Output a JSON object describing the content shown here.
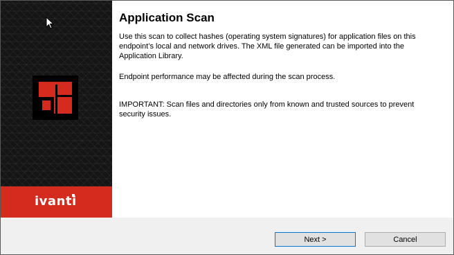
{
  "dialog": {
    "title": "Application Scan",
    "paragraphs": [
      "Use this scan to collect hashes (operating system signatures) for application files on this endpoint’s local and network drives. The XML file generated can be imported into the Application Library.",
      "Endpoint performance may be affected during the scan process.",
      "IMPORTANT: Scan files and directories only from known and trusted sources to prevent security issues."
    ]
  },
  "brand": {
    "name": "ivanti",
    "color": "#d52b1e",
    "logo_icon": "ivanti-logo-icon"
  },
  "buttons": {
    "next_label": "Next >",
    "cancel_label": "Cancel"
  },
  "cursor_icon": "mouse-pointer-icon"
}
